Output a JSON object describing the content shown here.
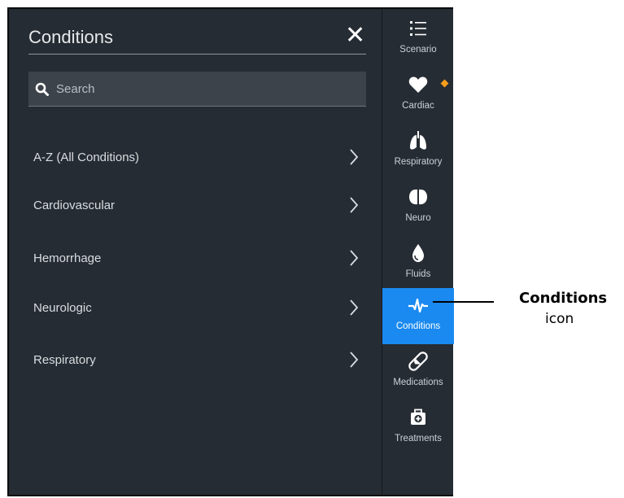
{
  "panel": {
    "title": "Conditions",
    "close_glyph": "✕",
    "search": {
      "placeholder": "Search",
      "value": "",
      "icon": "search-icon"
    },
    "categories": [
      {
        "label": "A-Z (All Conditions)",
        "icon": "chevron-right-icon"
      },
      {
        "label": "Cardiovascular",
        "icon": "chevron-right-icon"
      },
      {
        "label": "Hemorrhage",
        "icon": "chevron-right-icon"
      },
      {
        "label": "Neurologic",
        "icon": "chevron-right-icon"
      },
      {
        "label": "Respiratory",
        "icon": "chevron-right-icon"
      }
    ]
  },
  "sidebar": {
    "items": [
      {
        "label": "Scenario",
        "icon": "list-icon",
        "active": false
      },
      {
        "label": "Cardiac",
        "icon": "heart-icon",
        "active": false,
        "alert_color": "#f59d1b"
      },
      {
        "label": "Respiratory",
        "icon": "lungs-icon",
        "active": false
      },
      {
        "label": "Neuro",
        "icon": "brain-icon",
        "active": false
      },
      {
        "label": "Fluids",
        "icon": "drop-icon",
        "active": false
      },
      {
        "label": "Conditions",
        "icon": "pulse-icon",
        "active": true
      },
      {
        "label": "Medications",
        "icon": "pill-icon",
        "active": false
      },
      {
        "label": "Treatments",
        "icon": "first-aid-kit-icon",
        "active": false
      }
    ]
  },
  "callout": {
    "title": "Conditions",
    "subtitle": "icon"
  },
  "colors": {
    "background": "#262c33",
    "active": "#1a8af0",
    "alert": "#f59d1b",
    "text": "#d9dde1"
  }
}
